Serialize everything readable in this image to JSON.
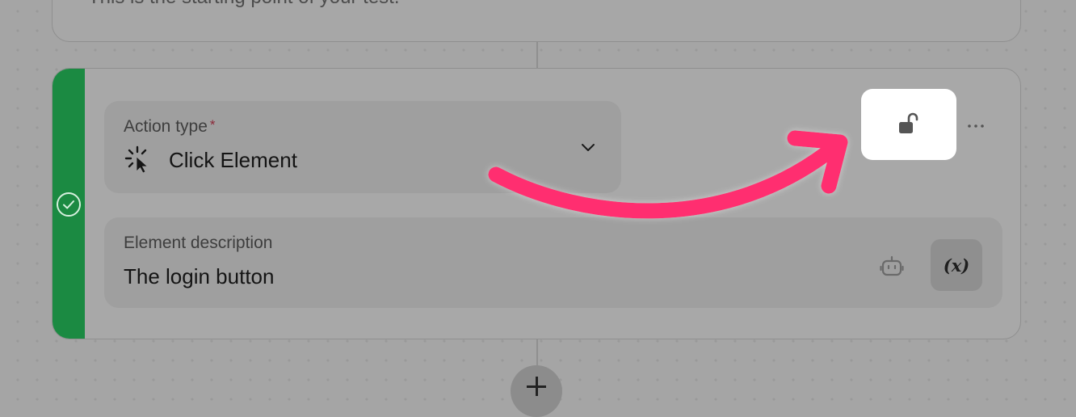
{
  "previous_step": {
    "description": "This is the starting point of your test."
  },
  "action_step": {
    "status_icon": "check-circle-icon",
    "status_color": "#1b8a42",
    "action_type": {
      "label": "Action type",
      "required_marker": "*",
      "value": "Click Element",
      "icon": "click-pointer-icon",
      "dropdown_icon": "chevron-down-icon"
    },
    "element_description": {
      "label": "Element description",
      "value": "The login button",
      "ai_icon": "robot-icon",
      "variable_label": "(x)"
    },
    "lock_icon": "unlock-icon",
    "more_icon": "ellipsis-icon"
  },
  "annotation": {
    "type": "arrow",
    "color": "#ff2e6f",
    "points_to": "lock-button"
  },
  "add_step_icon": "plus-icon"
}
